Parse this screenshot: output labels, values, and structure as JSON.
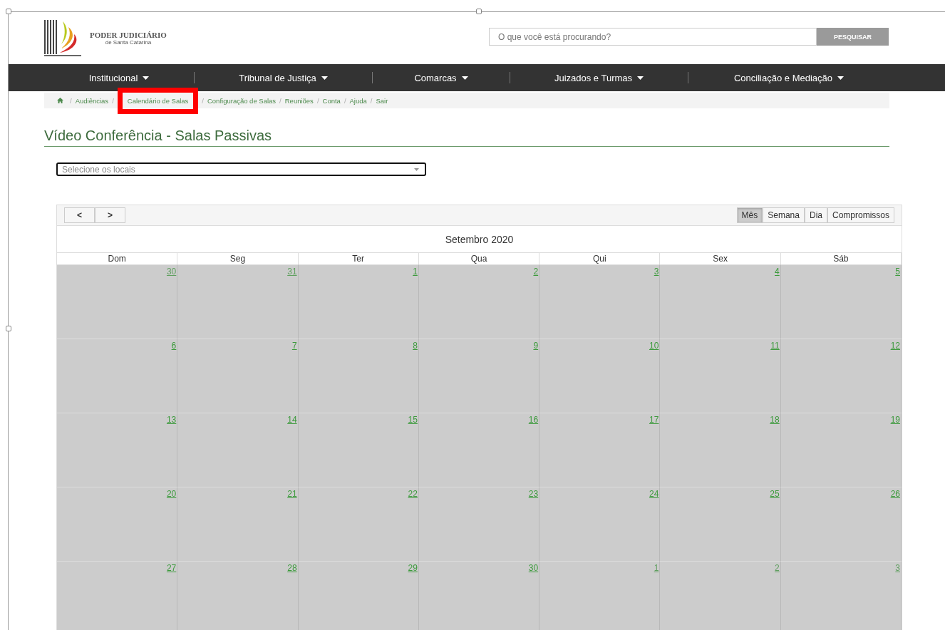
{
  "header": {
    "logo": {
      "title": "PODER JUDICIÁRIO",
      "subtitle": "de Santa Catarina"
    },
    "search": {
      "placeholder": "O que você está procurando?",
      "button": "PESQUISAR"
    }
  },
  "nav": [
    "Institucional",
    "Tribunal de Justiça",
    "Comarcas",
    "Juizados e Turmas",
    "Conciliação e Mediação"
  ],
  "breadcrumb_separator": "/",
  "breadcrumb": [
    {
      "label": "Audiências",
      "highlighted": false
    },
    {
      "label": "Calendário de Salas",
      "highlighted": true
    },
    {
      "label": "Configuração de Salas",
      "highlighted": false
    },
    {
      "label": "Reuniões",
      "highlighted": false
    },
    {
      "label": "Conta",
      "highlighted": false
    },
    {
      "label": "Ajuda",
      "highlighted": false
    },
    {
      "label": "Sair",
      "highlighted": false
    }
  ],
  "page_title": "Vídeo Conferência - Salas Passivas",
  "location_select": {
    "placeholder": "Selecione os locais"
  },
  "calendar": {
    "prev": "<",
    "next": ">",
    "title": "Setembro 2020",
    "views": [
      {
        "label": "Mês",
        "selected": true
      },
      {
        "label": "Semana",
        "selected": false
      },
      {
        "label": "Dia",
        "selected": false
      },
      {
        "label": "Compromissos",
        "selected": false
      }
    ],
    "weekdays": [
      "Dom",
      "Seg",
      "Ter",
      "Qua",
      "Qui",
      "Sex",
      "Sáb"
    ],
    "weeks": [
      [
        {
          "day": "30",
          "other_month": true
        },
        {
          "day": "31",
          "other_month": true
        },
        {
          "day": "1",
          "other_month": false
        },
        {
          "day": "2",
          "other_month": false
        },
        {
          "day": "3",
          "other_month": false
        },
        {
          "day": "4",
          "other_month": false
        },
        {
          "day": "5",
          "other_month": false
        }
      ],
      [
        {
          "day": "6",
          "other_month": false
        },
        {
          "day": "7",
          "other_month": false
        },
        {
          "day": "8",
          "other_month": false
        },
        {
          "day": "9",
          "other_month": false
        },
        {
          "day": "10",
          "other_month": false
        },
        {
          "day": "11",
          "other_month": false
        },
        {
          "day": "12",
          "other_month": false
        }
      ],
      [
        {
          "day": "13",
          "other_month": false
        },
        {
          "day": "14",
          "other_month": false
        },
        {
          "day": "15",
          "other_month": false
        },
        {
          "day": "16",
          "other_month": false
        },
        {
          "day": "17",
          "other_month": false
        },
        {
          "day": "18",
          "other_month": false
        },
        {
          "day": "19",
          "other_month": false
        }
      ],
      [
        {
          "day": "20",
          "other_month": false
        },
        {
          "day": "21",
          "other_month": false
        },
        {
          "day": "22",
          "other_month": false
        },
        {
          "day": "23",
          "other_month": false
        },
        {
          "day": "24",
          "other_month": false
        },
        {
          "day": "25",
          "other_month": false
        },
        {
          "day": "26",
          "other_month": false
        }
      ],
      [
        {
          "day": "27",
          "other_month": false
        },
        {
          "day": "28",
          "other_month": false
        },
        {
          "day": "29",
          "other_month": false
        },
        {
          "day": "30",
          "other_month": false
        },
        {
          "day": "1",
          "other_month": true
        },
        {
          "day": "2",
          "other_month": true
        },
        {
          "day": "3",
          "other_month": true
        }
      ]
    ]
  }
}
